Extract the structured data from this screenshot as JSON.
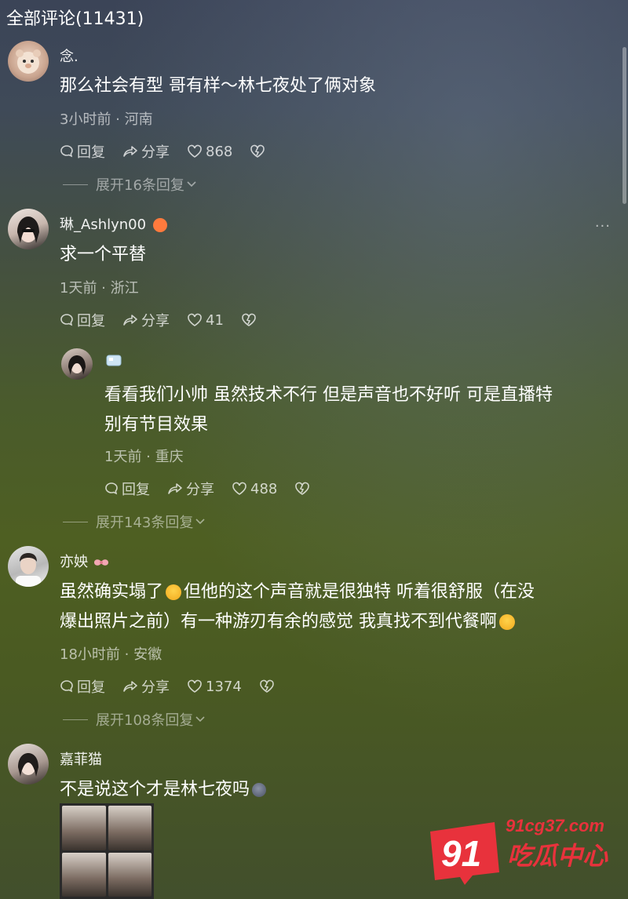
{
  "header": {
    "title": "全部评论(11431)"
  },
  "comments": [
    {
      "username": "念.",
      "text": "那么社会有型 哥有样～林七夜处了俩对象",
      "meta": "3小时前 · 河南",
      "actions": {
        "reply": "回复",
        "share": "分享",
        "likes": "868"
      },
      "expand": "展开16条回复"
    },
    {
      "username": "琳_Ashlyn00",
      "text": "求一个平替",
      "meta": "1天前 · 浙江",
      "actions": {
        "reply": "回复",
        "share": "分享",
        "likes": "41"
      },
      "more": "···",
      "reply": {
        "text_line1": "看看我们小帅 虽然技术不行 但是声音也不好听 可是直播特",
        "text_line2": "别有节目效果",
        "meta": "1天前 · 重庆",
        "actions": {
          "reply": "回复",
          "share": "分享",
          "likes": "488"
        }
      },
      "expand": "展开143条回复"
    },
    {
      "username": "亦姎",
      "text_line1": "虽然确实塌了",
      "text_line1b": "但他的这个声音就是很独特 听着很舒服（在没",
      "text_line2": "爆出照片之前）有一种游刃有余的感觉 我真找不到代餐啊",
      "meta": "18小时前 · 安徽",
      "actions": {
        "reply": "回复",
        "share": "分享",
        "likes": "1374"
      },
      "expand": "展开108条回复"
    },
    {
      "username": "嘉菲猫",
      "text": "不是说这个才是林七夜吗"
    }
  ],
  "watermark": {
    "site": "91cg37.com",
    "number": "91",
    "name": "吃瓜中心"
  },
  "colors": {
    "heart_badge": "#ff7a3d",
    "watermark_red": "#e8323c"
  }
}
